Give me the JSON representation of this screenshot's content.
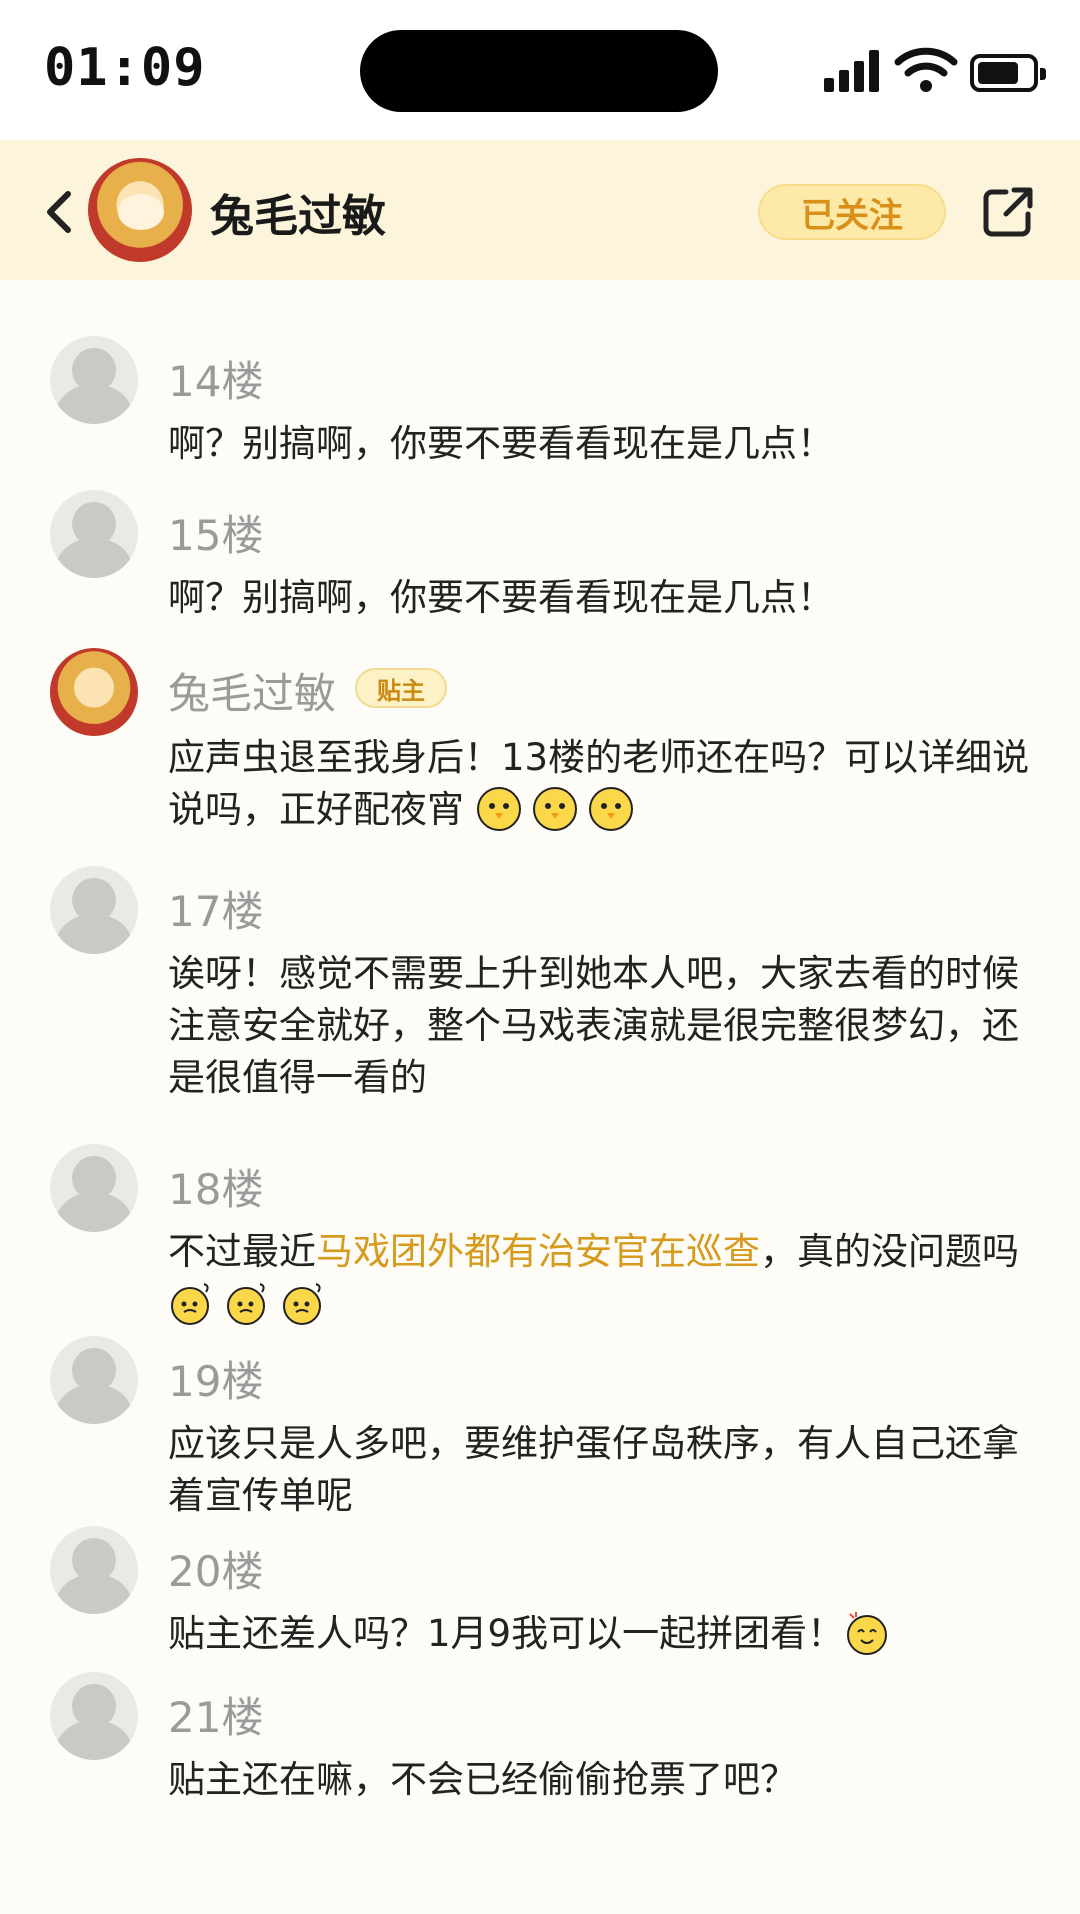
{
  "status_bar": {
    "time": "01:09"
  },
  "header": {
    "title": "兔毛过敏",
    "follow_label": "已关注"
  },
  "comments": [
    {
      "floor": "14楼",
      "text": "啊？别搞啊，你要不要看看现在是几点！"
    },
    {
      "floor": "15楼",
      "text": "啊？别搞啊，你要不要看看现在是几点！"
    },
    {
      "author": "兔毛过敏",
      "badge": "贴主",
      "text": "应声虫退至我身后！13楼的老师还在吗？可以详细说说吗，正好配夜宵"
    },
    {
      "floor": "17楼",
      "text": "诶呀！感觉不需要上升到她本人吧，大家去看的时候注意安全就好，整个马戏表演就是很完整很梦幻，还是很值得一看的"
    },
    {
      "floor": "18楼",
      "text_before": "不过最近",
      "text_highlight": "马戏团外都有治安官在巡查",
      "text_after": "，真的没问题吗"
    },
    {
      "floor": "19楼",
      "text": "应该只是人多吧，要维护蛋仔岛秩序，有人自己还拿着宣传单呢"
    },
    {
      "floor": "20楼",
      "text": "贴主还差人吗？1月9我可以一起拼团看！"
    },
    {
      "floor": "21楼",
      "text": "贴主还在嘛，不会已经偷偷抢票了吧？"
    }
  ],
  "colors": {
    "accent": "#d69a1c",
    "header_bg": "#fcf5dc",
    "page_bg": "#fdfcf7"
  },
  "icons": [
    "back-icon",
    "share-icon",
    "signal-icon",
    "wifi-icon",
    "battery-icon",
    "chick-emoji",
    "sweat-emoji",
    "happy-emoji"
  ]
}
